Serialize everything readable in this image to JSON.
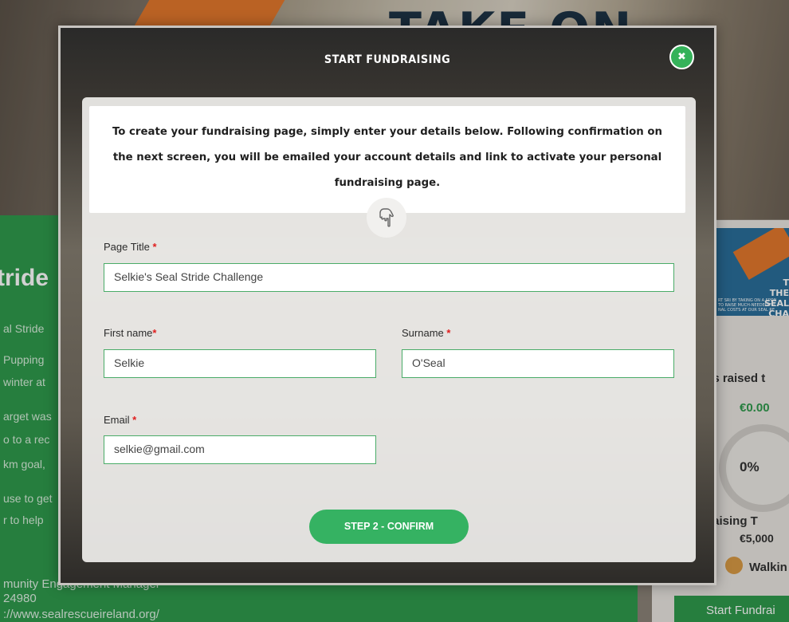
{
  "background": {
    "hero_title": "TAKE ON",
    "left_heading": "tride",
    "left_lines": [
      "al Stride",
      "Pupping",
      "winter at",
      "arget was",
      "o to a rec",
      "km goal,",
      "use to get",
      "r to help"
    ],
    "footer_lines": [
      "munity Engagement Manager",
      "24980",
      "://www.sealrescueireland.org/"
    ],
    "card_image_text": "T\nTHE SEAL\nCHA",
    "funds_raised_label": "nds raised t",
    "funds_raised_value": "€0.00",
    "progress_percent": "0%",
    "target_label": "ndraising T",
    "target_value": "€5,000",
    "activity_label": "Walkin",
    "start_button": "Start Fundrai"
  },
  "modal": {
    "title": "START FUNDRAISING",
    "close_icon": "close-x-icon",
    "intro": "To create your fundraising page, simply enter your details below. Following confirmation on the next screen, you will be emailed your account details and link to activate your personal fundraising page.",
    "hand_icon": "pointing-hand-icon",
    "fields": {
      "page_title": {
        "label": "Page Title ",
        "required": "*",
        "value": "Selkie's Seal Stride Challenge"
      },
      "first_name": {
        "label": "First name",
        "required": "*",
        "value": "Selkie"
      },
      "surname": {
        "label": "Surname ",
        "required": "*",
        "value": "O'Seal"
      },
      "email": {
        "label": "Email ",
        "required": "*",
        "value": "selkie@gmail.com"
      }
    },
    "confirm_button": "STEP 2 - CONFIRM"
  },
  "colors": {
    "accent_green": "#35b262",
    "required_red": "#e01e1e",
    "brand_orange": "#e3782c"
  }
}
